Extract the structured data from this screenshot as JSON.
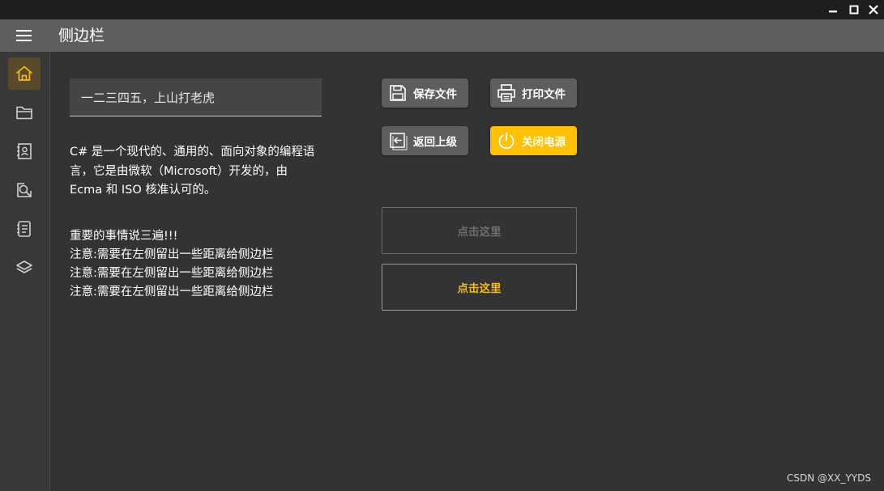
{
  "window": {
    "minimize_label": "minimize",
    "maximize_label": "maximize",
    "close_label": "close"
  },
  "appbar": {
    "title": "侧边栏"
  },
  "sidebar": {
    "items": [
      {
        "icon": "home-icon",
        "active": true
      },
      {
        "icon": "folder-icon",
        "active": false
      },
      {
        "icon": "contact-card-icon",
        "active": false
      },
      {
        "icon": "search-document-icon",
        "active": false
      },
      {
        "icon": "notes-list-icon",
        "active": false
      },
      {
        "icon": "layers-icon",
        "active": false
      }
    ]
  },
  "main": {
    "input_value": "一二三四五，上山打老虎",
    "paragraph_lines": [
      "C# 是一个现代的、通用的、面向对象的编程语",
      "言，它是由微软（Microsoft）开发的，由",
      "Ecma 和 ISO 核准认可的。"
    ],
    "notes": [
      "重要的事情说三遍!!!",
      "注意:需要在左侧留出一些距离给侧边栏",
      "注意:需要在左侧留出一些距离给侧边栏",
      "注意:需要在左侧留出一些距离给侧边栏"
    ]
  },
  "buttons": {
    "save_file": "保存文件",
    "print_file": "打印文件",
    "go_back": "返回上级",
    "power_off": "关闭电源",
    "click_here_disabled": "点击这里",
    "click_here_enabled": "点击这里"
  },
  "colors": {
    "accent": "#ffc107",
    "background": "#333333",
    "appbar": "#5e5e5e",
    "titlebar": "#1e1e1e"
  },
  "watermark": "CSDN @XX_YYDS"
}
